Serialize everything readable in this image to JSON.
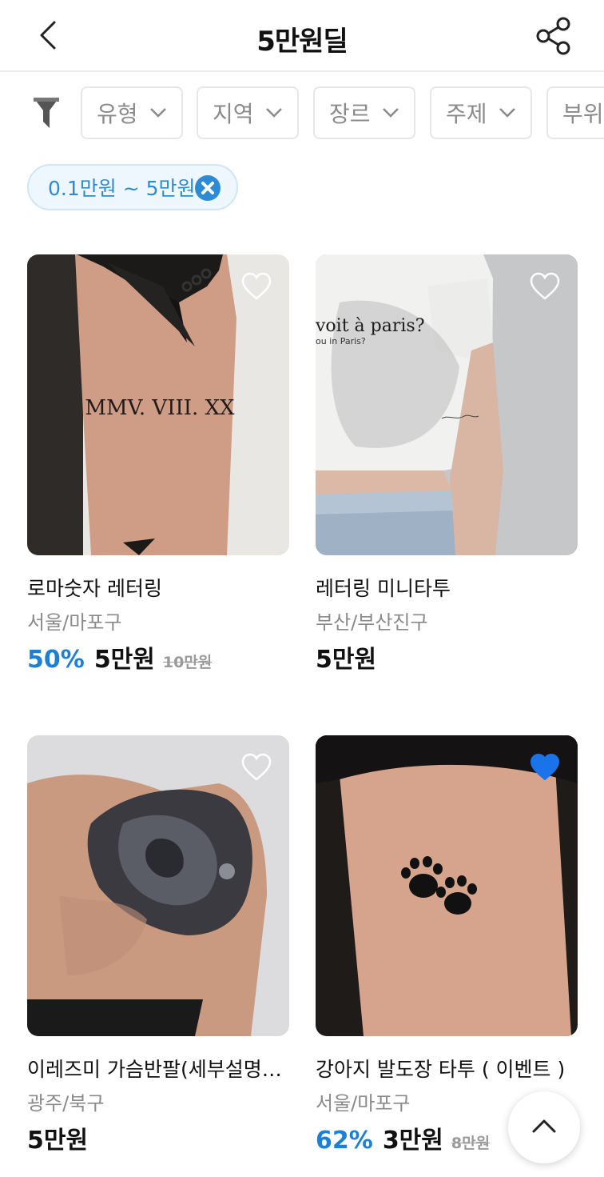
{
  "header": {
    "title": "5만원딜",
    "back_icon": "chevron-left-icon",
    "share_icon": "share-icon"
  },
  "filters": {
    "icon": "funnel-icon",
    "chips": [
      {
        "label": "유형"
      },
      {
        "label": "지역"
      },
      {
        "label": "장르"
      },
      {
        "label": "주제"
      },
      {
        "label": "부위"
      }
    ]
  },
  "active_filter": {
    "label": "0.1만원 ~ 5만원",
    "clear_icon": "close-circle-icon"
  },
  "products": [
    {
      "title": "로마숫자 레터링",
      "location": "서울/마포구",
      "discount": "50%",
      "price": "5만원",
      "original_price": "10만원",
      "liked": false,
      "image_text": "MMV. VIII. XX"
    },
    {
      "title": "레터링 미니타투",
      "location": "부산/부산진구",
      "discount": "",
      "price": "5만원",
      "original_price": "",
      "liked": false,
      "image_text": "voit à paris?",
      "image_subtext": "ou in Paris?"
    },
    {
      "title": "이레즈미 가슴반팔(세부설명…",
      "location": "광주/북구",
      "discount": "",
      "price": "5만원",
      "original_price": "",
      "liked": false
    },
    {
      "title": "강아지 발도장 타투 ( 이벤트 )",
      "location": "서울/마포구",
      "discount": "62%",
      "price": "3만원",
      "original_price": "8만원",
      "liked": true
    }
  ],
  "scroll_top_icon": "chevron-up-icon",
  "colors": {
    "accent": "#1e7fd6",
    "liked_heart": "#1a73e8",
    "chip_border": "#e7e7e7",
    "muted_text": "#8a8a8a"
  }
}
